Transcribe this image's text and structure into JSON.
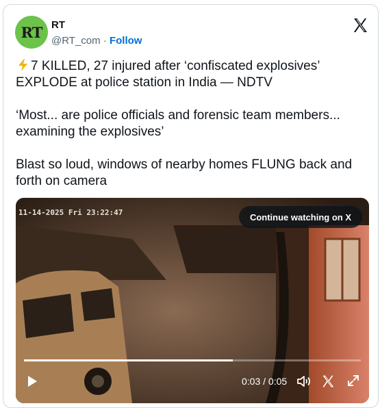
{
  "account": {
    "avatar_text": "RT",
    "name": "RT",
    "handle": "@RT_com",
    "separator": "·",
    "follow_label": "Follow"
  },
  "tweet": {
    "line1": "7 KILLED, 27 injured after ‘confiscated explosives’ EXPLODE at police station in India — NDTV",
    "line2": "‘Most... are police officials and forensic team members... examining the explosives’",
    "line3": "Blast so loud, windows of nearby homes FLUNG back and forth on camera"
  },
  "video": {
    "overlay_timestamp": "11-14-2025 Fri 23:22:47",
    "continue_label": "Continue watching on X",
    "current_time": "0:03",
    "duration": "0:05",
    "time_sep": "/",
    "progress_fraction": 0.62
  },
  "colors": {
    "follow": "#006fd6",
    "avatar_bg": "#6cc24a"
  }
}
